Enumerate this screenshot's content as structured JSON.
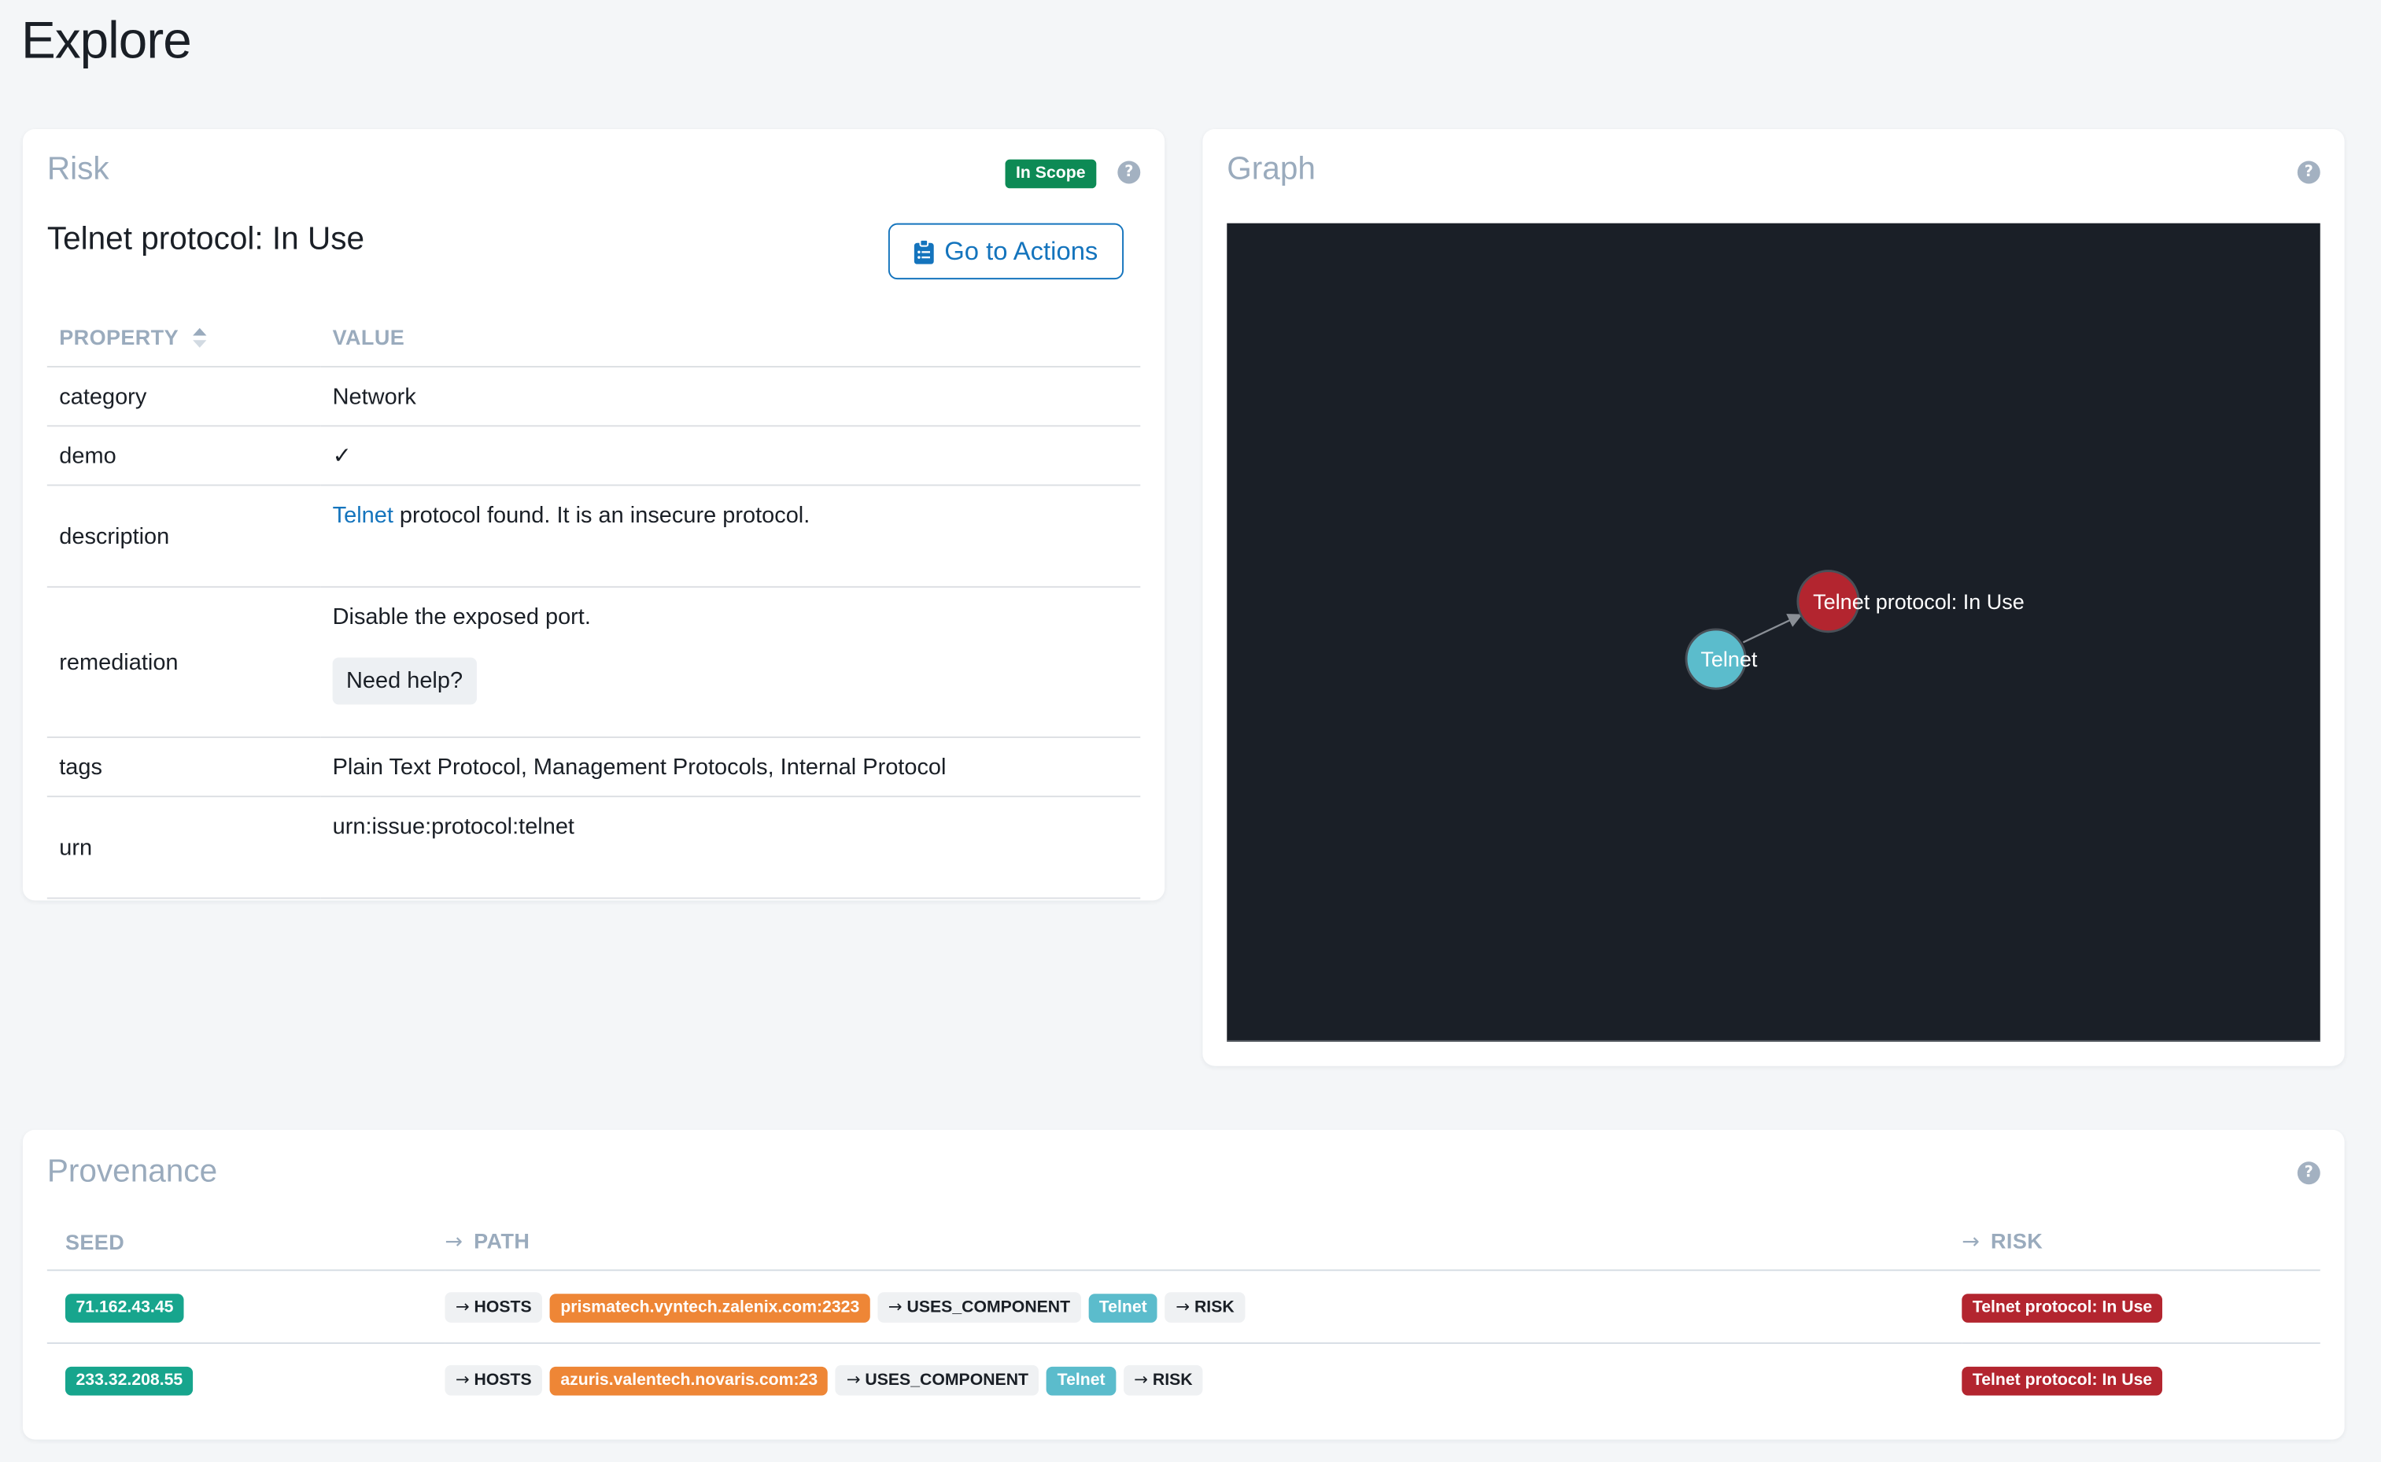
{
  "page": {
    "title": "Explore"
  },
  "risk_card": {
    "title": "Risk",
    "scope_badge": "In Scope",
    "help_icon_label": "?",
    "risk_name": "Telnet protocol: In Use",
    "actions_button": {
      "label": "Go to Actions",
      "icon": "clipboard-list-icon"
    },
    "table": {
      "headers": {
        "property": "PROPERTY",
        "value": "VALUE"
      },
      "rows": {
        "category": {
          "key": "category",
          "value": "Network"
        },
        "demo": {
          "key": "demo",
          "value": "✓"
        },
        "description": {
          "key": "description",
          "link_text": "Telnet",
          "value": " protocol found. It is an insecure protocol."
        },
        "remediation": {
          "key": "remediation",
          "value": "Disable the exposed port.",
          "help_button": "Need help?"
        },
        "tags": {
          "key": "tags",
          "value": "Plain Text Protocol, Management Protocols, Internal Protocol"
        },
        "urn": {
          "key": "urn",
          "value": "urn:issue:protocol:telnet"
        }
      }
    }
  },
  "graph_card": {
    "title": "Graph",
    "help_icon_label": "?",
    "nodes": [
      {
        "id": "telnet",
        "label": "Telnet",
        "color": "#5bbccc"
      },
      {
        "id": "risk",
        "label": "Telnet protocol: In Use",
        "color": "#b3252f"
      }
    ],
    "edges": [
      {
        "from": "telnet",
        "to": "risk"
      }
    ]
  },
  "provenance_card": {
    "title": "Provenance",
    "help_icon_label": "?",
    "headers": {
      "seed": "SEED",
      "path": "PATH",
      "risk": "RISK",
      "arrow": "→"
    },
    "rows": [
      {
        "seed": "71.162.43.45",
        "path": [
          {
            "type": "edge",
            "label": "HOSTS"
          },
          {
            "type": "host",
            "label": "prismatech.vyntech.zalenix.com:2323"
          },
          {
            "type": "edge",
            "label": "USES_COMPONENT"
          },
          {
            "type": "comp",
            "label": "Telnet"
          },
          {
            "type": "edge",
            "label": "RISK"
          }
        ],
        "risk": "Telnet protocol: In Use"
      },
      {
        "seed": "233.32.208.55",
        "path": [
          {
            "type": "edge",
            "label": "HOSTS"
          },
          {
            "type": "host",
            "label": "azuris.valentech.novaris.com:23"
          },
          {
            "type": "edge",
            "label": "USES_COMPONENT"
          },
          {
            "type": "comp",
            "label": "Telnet"
          },
          {
            "type": "edge",
            "label": "RISK"
          }
        ],
        "risk": "Telnet protocol: In Use"
      }
    ]
  },
  "colors": {
    "accent": "#1474bd",
    "scope_green": "#0d8a55",
    "seed_teal": "#17a58d",
    "host_orange": "#ee8636",
    "component_cyan": "#5bbccc",
    "risk_red": "#b3252f",
    "graph_bg": "#1a1f27"
  }
}
